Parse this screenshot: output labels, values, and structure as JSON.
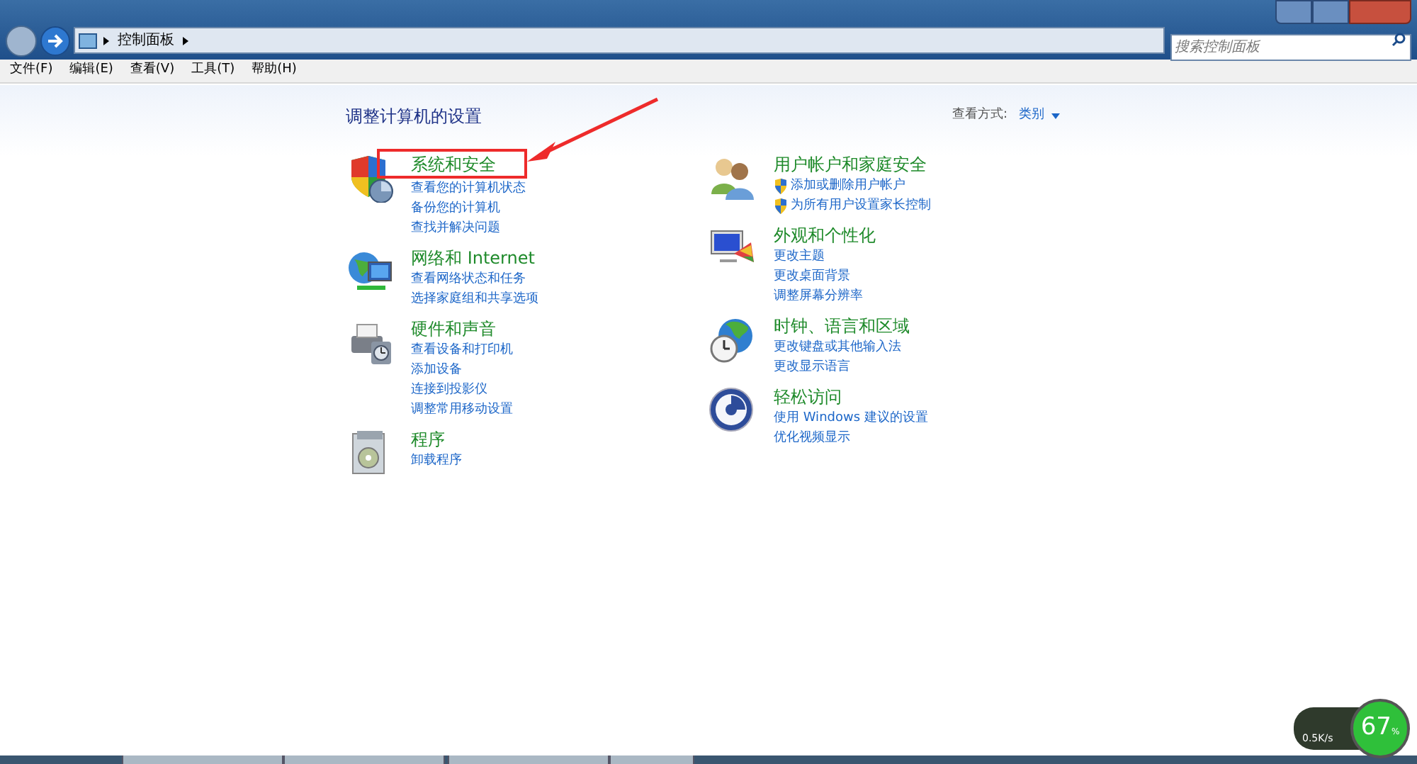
{
  "address_bar": {
    "path": "控制面板",
    "search_placeholder": "搜索控制面板"
  },
  "menu": [
    "文件(F)",
    "编辑(E)",
    "查看(V)",
    "工具(T)",
    "帮助(H)"
  ],
  "heading": "调整计算机的设置",
  "view_by": {
    "label": "查看方式:",
    "value": "类别"
  },
  "columns": [
    [
      {
        "kind": "shield",
        "title": "系统和安全",
        "highlighted": true,
        "links": [
          {
            "text": "查看您的计算机状态",
            "shield": false
          },
          {
            "text": "备份您的计算机",
            "shield": false
          },
          {
            "text": "查找并解决问题",
            "shield": false
          }
        ]
      },
      {
        "kind": "network",
        "title": "网络和 Internet",
        "highlighted": false,
        "links": [
          {
            "text": "查看网络状态和任务",
            "shield": false
          },
          {
            "text": "选择家庭组和共享选项",
            "shield": false
          }
        ]
      },
      {
        "kind": "printer",
        "title": "硬件和声音",
        "highlighted": false,
        "links": [
          {
            "text": "查看设备和打印机",
            "shield": false
          },
          {
            "text": "添加设备",
            "shield": false
          },
          {
            "text": "连接到投影仪",
            "shield": false
          },
          {
            "text": "调整常用移动设置",
            "shield": false
          }
        ]
      },
      {
        "kind": "programs",
        "title": "程序",
        "highlighted": false,
        "links": [
          {
            "text": "卸载程序",
            "shield": false
          }
        ]
      }
    ],
    [
      {
        "kind": "users",
        "title": "用户帐户和家庭安全",
        "highlighted": false,
        "links": [
          {
            "text": "添加或删除用户帐户",
            "shield": true
          },
          {
            "text": "为所有用户设置家长控制",
            "shield": true
          }
        ]
      },
      {
        "kind": "monitor",
        "title": "外观和个性化",
        "highlighted": false,
        "links": [
          {
            "text": "更改主题",
            "shield": false
          },
          {
            "text": "更改桌面背景",
            "shield": false
          },
          {
            "text": "调整屏幕分辨率",
            "shield": false
          }
        ]
      },
      {
        "kind": "globe",
        "title": "时钟、语言和区域",
        "highlighted": false,
        "links": [
          {
            "text": "更改键盘或其他输入法",
            "shield": false
          },
          {
            "text": "更改显示语言",
            "shield": false
          }
        ]
      },
      {
        "kind": "access",
        "title": "轻松访问",
        "highlighted": false,
        "links": [
          {
            "text": "使用 Windows 建议的设置",
            "shield": false
          },
          {
            "text": "优化视频显示",
            "shield": false
          }
        ]
      }
    ]
  ],
  "net_widget": {
    "download": "0.5K/s",
    "percent": "67",
    "unit": "%"
  }
}
